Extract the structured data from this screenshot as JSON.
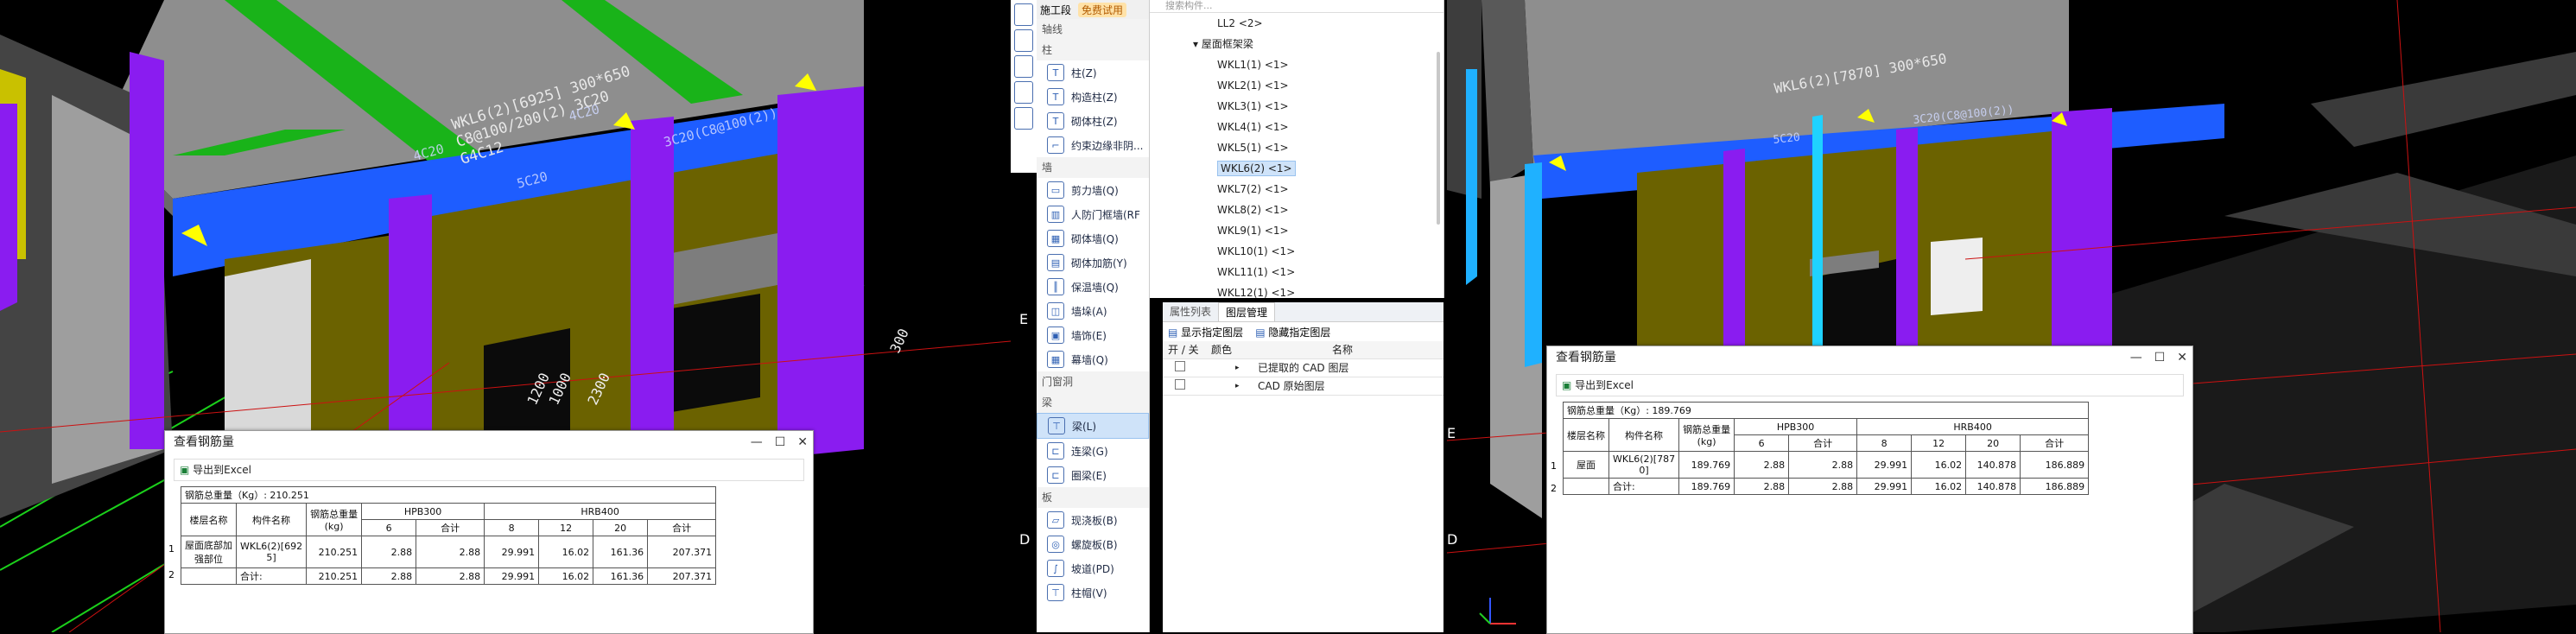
{
  "scene_left": {
    "label_main_line1": "WKL6(2)[6925] 300*650",
    "label_main_line2": "C8@100/200(2) 3C20",
    "label_main_line3": "G4C12",
    "beam_label_4c20_a": "4C20",
    "beam_label_4c20_b": "4C20",
    "beam_label_5c20": "5C20",
    "beam_label_3c20": "3C20(C8@100(2))",
    "dim_1": "1200",
    "dim_2": "1000",
    "dim_3": "2300",
    "dim_4": "300"
  },
  "dialog_left": {
    "title": "查看钢筋量",
    "export_label": "导出到Excel",
    "total_label": "钢筋总重量（Kg）: 210.251",
    "headers": {
      "floor_name": "楼层名称",
      "member_name": "构件名称",
      "total_weight": "钢筋总重量\n(kg)",
      "hpb300": "HPB300",
      "hrb400": "HRB400",
      "d6": "6",
      "subtotal1": "合计",
      "d8": "8",
      "d12": "12",
      "d20": "20",
      "subtotal2": "合计"
    },
    "rows": [
      {
        "idx": "1",
        "floor": "屋面底部加\n强部位",
        "member": "WKL6(2)[692\n5]",
        "total": "210.251",
        "d6": "2.88",
        "sub1": "2.88",
        "d8": "29.991",
        "d12": "16.02",
        "d20": "161.36",
        "sub2": "207.371"
      },
      {
        "idx": "2",
        "floor": "",
        "member": "合计:",
        "total": "210.251",
        "d6": "2.88",
        "sub1": "2.88",
        "d8": "29.991",
        "d12": "16.02",
        "d20": "161.36",
        "sub2": "207.371"
      }
    ]
  },
  "ribbon": {
    "top_tab": "施工段",
    "badge": "免费试用",
    "sections": [
      {
        "title": "轴线",
        "items": []
      },
      {
        "title": "柱",
        "items": [
          "柱(Z)",
          "构造柱(Z)",
          "砌体柱(Z)",
          "约束边缘非阴..."
        ]
      },
      {
        "title": "墙",
        "items": [
          "剪力墙(Q)",
          "人防门框墙(RF",
          "砌体墙(Q)",
          "砌体加筋(Y)",
          "保温墙(Q)",
          "墙垛(A)",
          "墙饰(E)",
          "幕墙(Q)"
        ]
      },
      {
        "title": "门窗洞",
        "items": []
      },
      {
        "title": "梁",
        "items": [
          "梁(L)",
          "连梁(G)",
          "圈梁(E)"
        ]
      },
      {
        "title": "板",
        "items": [
          "现浇板(B)",
          "螺旋板(B)",
          "坡道(PD)",
          "柱帽(V)"
        ]
      }
    ]
  },
  "tree": {
    "search_placeholder": "搜索构件...",
    "ll2": "LL2 <2>",
    "group": "屋面框架梁",
    "items": [
      "WKL1(1) <1>",
      "WKL2(1) <1>",
      "WKL3(1) <1>",
      "WKL4(1) <1>",
      "WKL5(1) <1>",
      "WKL6(2) <1>",
      "WKL7(2) <1>",
      "WKL8(2) <1>",
      "WKL9(1) <1>",
      "WKL10(1) <1>",
      "WKL11(1) <1>",
      "WKL12(1) <1>"
    ],
    "selected_index": 5
  },
  "layers": {
    "tab_props": "属性列表",
    "tab_layers": "图层管理",
    "show_btn": "显示指定图层",
    "hide_btn": "隐藏指定图层",
    "col_onoff": "开 / 关",
    "col_color": "颜色",
    "col_name": "名称",
    "rows": [
      "已提取的 CAD 图层",
      "CAD 原始图层"
    ]
  },
  "axis_labels": {
    "e_mid": "E",
    "d_mid": "D",
    "e_right": "E",
    "d_right": "D"
  },
  "dialog_right": {
    "title": "查看钢筋量",
    "export_label": "导出到Excel",
    "total_label": "钢筋总重量（Kg）: 189.769",
    "rows": [
      {
        "idx": "1",
        "floor": "屋面",
        "member": "WKL6(2)[787\n0]",
        "total": "189.769",
        "d6": "2.88",
        "sub1": "2.88",
        "d8": "29.991",
        "d12": "16.02",
        "d20": "140.878",
        "sub2": "186.889"
      },
      {
        "idx": "2",
        "floor": "",
        "member": "合计:",
        "total": "189.769",
        "d6": "2.88",
        "sub1": "2.88",
        "d8": "29.991",
        "d12": "16.02",
        "d20": "140.878",
        "sub2": "186.889"
      }
    ]
  },
  "scene_right": {
    "label_main_line1": "WKL6(2)[7870] 300*650",
    "beam_label_5c20": "5C20",
    "beam_label_3c20": "3C20(C8@100(2))"
  },
  "colors": {
    "purple": "#8a1cf0",
    "blue": "#1e5dff",
    "olive": "#6b6200",
    "green": "#1db31d",
    "gray": "#8c8c8c"
  }
}
